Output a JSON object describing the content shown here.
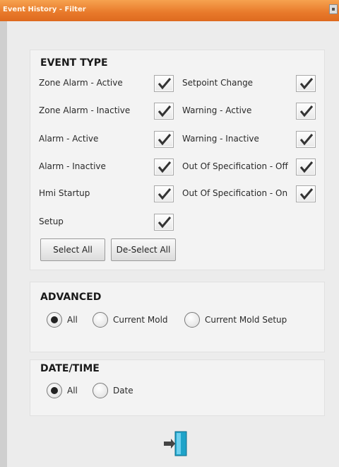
{
  "window": {
    "title": "Event History - Filter"
  },
  "event_type": {
    "heading": "EVENT TYPE",
    "left": [
      {
        "label": "Zone Alarm - Active",
        "checked": true
      },
      {
        "label": "Zone Alarm - Inactive",
        "checked": true
      },
      {
        "label": "Alarm - Active",
        "checked": true
      },
      {
        "label": "Alarm - Inactive",
        "checked": true
      },
      {
        "label": "Hmi Startup",
        "checked": true
      },
      {
        "label": "Setup",
        "checked": true
      }
    ],
    "right": [
      {
        "label": "Setpoint Change",
        "checked": true
      },
      {
        "label": "Warning - Active",
        "checked": true
      },
      {
        "label": "Warning - Inactive",
        "checked": true
      },
      {
        "label": "Out Of Specification - Off",
        "checked": true
      },
      {
        "label": "Out Of Specification - On",
        "checked": true
      }
    ],
    "select_all_label": "Select All",
    "deselect_all_label": "De-Select All"
  },
  "advanced": {
    "heading": "ADVANCED",
    "options": [
      {
        "label": "All",
        "selected": true
      },
      {
        "label": "Current Mold",
        "selected": false
      },
      {
        "label": "Current Mold Setup",
        "selected": false
      }
    ]
  },
  "datetime": {
    "heading": "DATE/TIME",
    "options": [
      {
        "label": "All",
        "selected": true
      },
      {
        "label": "Date",
        "selected": false
      }
    ]
  },
  "colors": {
    "title_bar": "#e8792a",
    "exit_icon": "#1fa3c9"
  },
  "icons": {
    "exit": "exit-door-icon",
    "check": "checkmark-icon"
  }
}
